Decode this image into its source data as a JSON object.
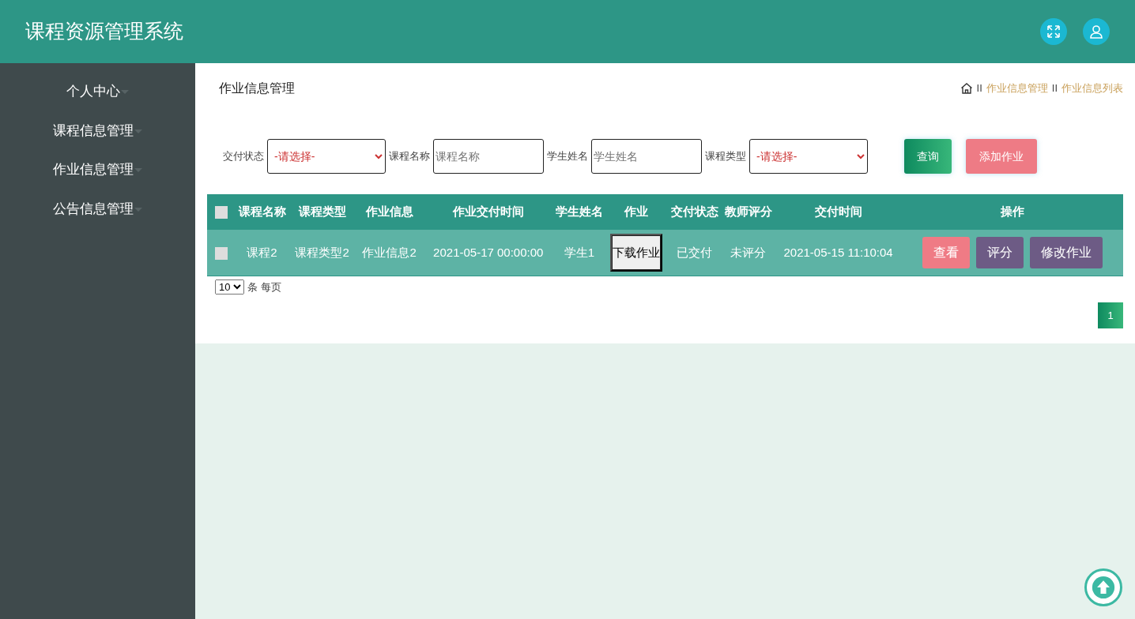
{
  "header": {
    "title": "课程资源管理系统",
    "buttons": [
      {
        "kind": "fullscreen"
      },
      {
        "kind": "user"
      }
    ]
  },
  "sidebar": {
    "items": [
      {
        "label": "个人中心",
        "expanded": false
      },
      {
        "label": "课程信息管理",
        "expanded": false
      },
      {
        "label": "作业信息管理",
        "expanded": false
      },
      {
        "label": "公告信息管理",
        "expanded": false
      }
    ]
  },
  "page_title": "作业信息管理",
  "breadcrumb": {
    "items": [
      {
        "separator": "II",
        "label": "作业信息管理"
      },
      {
        "separator": "II",
        "label": "作业信息列表"
      }
    ]
  },
  "filters": [
    {
      "kind": "select",
      "label": "交付状态",
      "value": "-请选择-"
    },
    {
      "kind": "input",
      "label": "课程名称",
      "placeholder": "课程名称"
    },
    {
      "kind": "input",
      "label": "学生姓名",
      "placeholder": "学生姓名"
    },
    {
      "kind": "select",
      "label": "课程类型",
      "value": "-请选择-"
    }
  ],
  "filter_buttons": [
    {
      "kind": "search",
      "label": "查询"
    },
    {
      "kind": "add",
      "label": "添加作业"
    }
  ],
  "table": {
    "header_checked": false,
    "columns": [
      "课程名称",
      "课程类型",
      "作业信息",
      "作业交付时间",
      "学生姓名",
      "作业",
      "交付状态",
      "教师评分",
      "交付时间",
      "操作"
    ],
    "rows": [
      {
        "checked": false,
        "cells": [
          "课程2",
          "课程类型2",
          "作业信息2",
          "2021-05-17 00:00:00",
          "学生1"
        ],
        "download": "下载作业",
        "status": "已交付",
        "score": "未评分",
        "time": "2021-05-15 11:10:04",
        "actions": [
          {
            "kind": "view",
            "label": "查看"
          },
          {
            "kind": "grade",
            "label": "评分"
          },
          {
            "kind": "edit",
            "label": "修改作业"
          }
        ]
      }
    ]
  },
  "page_size": {
    "value": "10",
    "suffix": "条 每页"
  },
  "pagination": [
    {
      "label": "1",
      "selected": true
    }
  ]
}
